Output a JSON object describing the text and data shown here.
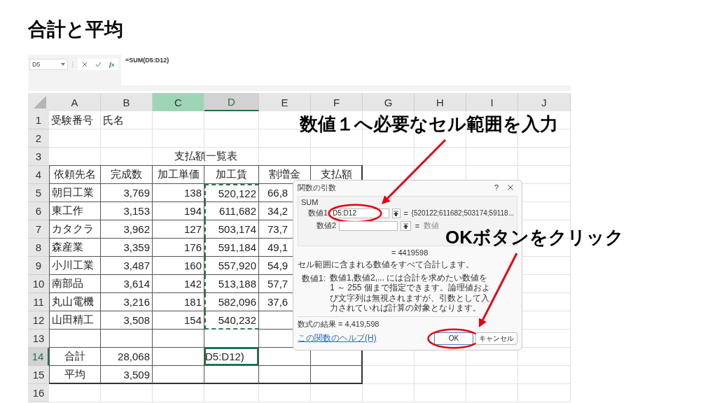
{
  "slide_title": "合計と平均",
  "excel": {
    "name_box": "D5",
    "formula": "=SUM(D5:D12)",
    "fx_label": "fx",
    "columns": [
      {
        "label": "A",
        "selected": false,
        "highlighted": false
      },
      {
        "label": "B",
        "selected": false,
        "highlighted": false
      },
      {
        "label": "C",
        "selected": false,
        "highlighted": true
      },
      {
        "label": "D",
        "selected": true,
        "highlighted": false
      },
      {
        "label": "E",
        "selected": false,
        "highlighted": false
      },
      {
        "label": "F",
        "selected": false,
        "highlighted": false
      },
      {
        "label": "G",
        "selected": false,
        "highlighted": false
      },
      {
        "label": "H",
        "selected": false,
        "highlighted": false
      },
      {
        "label": "I",
        "selected": false,
        "highlighted": false
      },
      {
        "label": "J",
        "selected": false,
        "highlighted": false
      }
    ],
    "rows": [
      {
        "number": "1",
        "kind": "plain",
        "active": false,
        "marked": false,
        "cells": [
          "受験番号",
          "氏名",
          "",
          "",
          "",
          ""
        ]
      },
      {
        "number": "2",
        "kind": "plain",
        "active": false,
        "marked": false,
        "cells": [
          "",
          "",
          "",
          "",
          "",
          ""
        ]
      },
      {
        "number": "3",
        "kind": "title",
        "active": false,
        "marked": false,
        "cells": [
          "",
          "",
          "支払額一覧表",
          "",
          "",
          ""
        ]
      },
      {
        "number": "4",
        "kind": "header",
        "active": false,
        "marked": false,
        "cells": [
          "依頼先名",
          "完成数",
          "加工単価",
          "加工賃",
          "割増金",
          "支払額"
        ]
      },
      {
        "number": "5",
        "kind": "data",
        "active": false,
        "marked": true,
        "cells": [
          "朝日工業",
          "3,769",
          "138",
          "520,122",
          "66,8",
          ""
        ]
      },
      {
        "number": "6",
        "kind": "data",
        "active": false,
        "marked": true,
        "cells": [
          "東工作",
          "3,153",
          "194",
          "611,682",
          "34,2",
          ""
        ]
      },
      {
        "number": "7",
        "kind": "data",
        "active": false,
        "marked": true,
        "cells": [
          "カタクラ",
          "3,962",
          "127",
          "503,174",
          "73,7",
          ""
        ]
      },
      {
        "number": "8",
        "kind": "data",
        "active": false,
        "marked": true,
        "cells": [
          "森産業",
          "3,359",
          "176",
          "591,184",
          "49,1",
          ""
        ]
      },
      {
        "number": "9",
        "kind": "data",
        "active": false,
        "marked": true,
        "cells": [
          "小川工業",
          "3,487",
          "160",
          "557,920",
          "54,9",
          ""
        ]
      },
      {
        "number": "10",
        "kind": "data",
        "active": false,
        "marked": true,
        "cells": [
          "南部品",
          "3,614",
          "142",
          "513,188",
          "57,7",
          ""
        ]
      },
      {
        "number": "11",
        "kind": "data",
        "active": false,
        "marked": true,
        "cells": [
          "丸山電機",
          "3,216",
          "181",
          "582,096",
          "37,6",
          ""
        ]
      },
      {
        "number": "12",
        "kind": "data",
        "active": false,
        "marked": true,
        "cells": [
          "山田精工",
          "3,508",
          "154",
          "540,232",
          "",
          ""
        ]
      },
      {
        "number": "13",
        "kind": "data",
        "active": false,
        "marked": false,
        "cells": [
          "",
          "",
          "",
          "",
          "",
          ""
        ]
      },
      {
        "number": "14",
        "kind": "total",
        "active": true,
        "marked": false,
        "cells": [
          "合計",
          "28,068",
          "",
          "D5:D12)",
          "",
          ""
        ]
      },
      {
        "number": "15",
        "kind": "total",
        "active": false,
        "marked": false,
        "cells": [
          "平均",
          "3,509",
          "",
          "",
          "",
          ""
        ]
      },
      {
        "number": "16",
        "kind": "plain",
        "active": false,
        "marked": false,
        "cells": [
          "",
          "",
          "",
          "",
          "",
          ""
        ]
      }
    ]
  },
  "dialog": {
    "title": "関数の引数",
    "help": "?",
    "function": "SUM",
    "args": [
      {
        "label": "数値1",
        "value": "D5:D12",
        "equals": "=",
        "preview": "{520122;611682;503174;59118...",
        "hint": false
      },
      {
        "label": "数値2",
        "equals": "=",
        "preview": "数値",
        "hint": true
      }
    ],
    "total": "= 4419598",
    "description": "セル範囲に含まれる数値をすべて合計します。",
    "arg_help_label": "数値1:",
    "arg_help": "数値1,数値2,... には合計を求めたい数値を 1 ～ 255 個まで指定できます。論理値および文字列は無視されますが、引数として入力されていれば計算の対象となります。",
    "result": "数式の結果 =  4,419,598",
    "help_link": "この関数のヘルプ(H)",
    "buttons": [
      {
        "label": "OK",
        "primary": true
      },
      {
        "label": "キャンセル",
        "primary": false
      }
    ]
  },
  "callouts": [
    {
      "text": "数値１へ必要なセル範囲を入力"
    },
    {
      "text": "OKボタンをクリック"
    }
  ]
}
